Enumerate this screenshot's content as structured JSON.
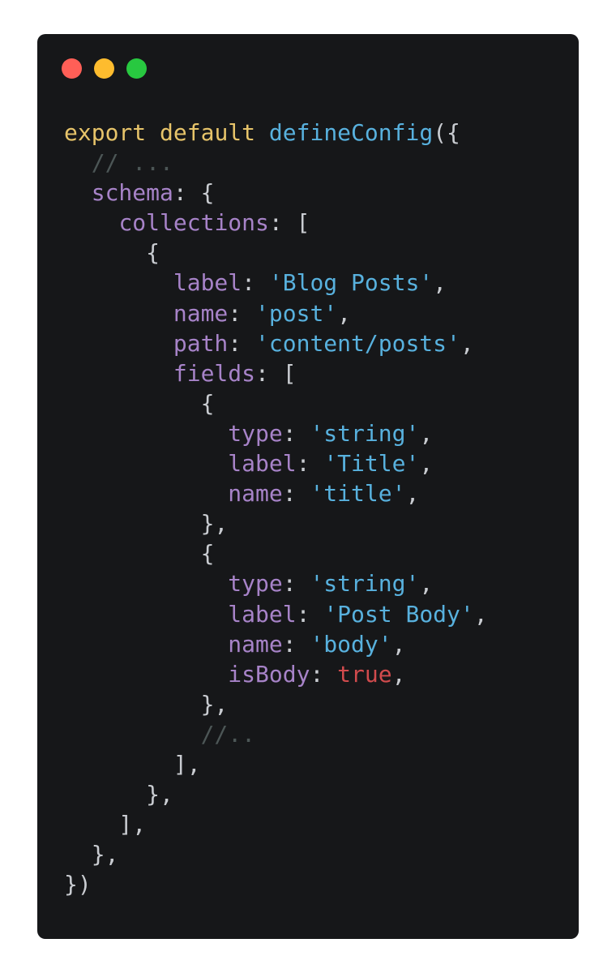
{
  "colors": {
    "background": "#161719",
    "plain": "#c9ccd1",
    "keyword": "#e7c46a",
    "function": "#58b1de",
    "property": "#a783c8",
    "string": "#58b1de",
    "comment": "#4c5656",
    "boolean": "#d14b4d",
    "close_dot": "#ff5f57",
    "minimize_dot": "#febc2e",
    "zoom_dot": "#28c840"
  },
  "code_lines": [
    [
      {
        "t": "keyword",
        "v": "export"
      },
      {
        "t": "plain",
        "v": " "
      },
      {
        "t": "keyword",
        "v": "default"
      },
      {
        "t": "plain",
        "v": " "
      },
      {
        "t": "function",
        "v": "defineConfig"
      },
      {
        "t": "plain",
        "v": "({"
      }
    ],
    [
      {
        "t": "plain",
        "v": "  "
      },
      {
        "t": "comment",
        "v": "// ..."
      }
    ],
    [
      {
        "t": "plain",
        "v": "  "
      },
      {
        "t": "property",
        "v": "schema"
      },
      {
        "t": "plain",
        "v": ": {"
      }
    ],
    [
      {
        "t": "plain",
        "v": "    "
      },
      {
        "t": "property",
        "v": "collections"
      },
      {
        "t": "plain",
        "v": ": ["
      }
    ],
    [
      {
        "t": "plain",
        "v": "      {"
      }
    ],
    [
      {
        "t": "plain",
        "v": "        "
      },
      {
        "t": "property",
        "v": "label"
      },
      {
        "t": "plain",
        "v": ": "
      },
      {
        "t": "string",
        "v": "'Blog Posts'"
      },
      {
        "t": "plain",
        "v": ","
      }
    ],
    [
      {
        "t": "plain",
        "v": "        "
      },
      {
        "t": "property",
        "v": "name"
      },
      {
        "t": "plain",
        "v": ": "
      },
      {
        "t": "string",
        "v": "'post'"
      },
      {
        "t": "plain",
        "v": ","
      }
    ],
    [
      {
        "t": "plain",
        "v": "        "
      },
      {
        "t": "property",
        "v": "path"
      },
      {
        "t": "plain",
        "v": ": "
      },
      {
        "t": "string",
        "v": "'content/posts'"
      },
      {
        "t": "plain",
        "v": ","
      }
    ],
    [
      {
        "t": "plain",
        "v": "        "
      },
      {
        "t": "property",
        "v": "fields"
      },
      {
        "t": "plain",
        "v": ": ["
      }
    ],
    [
      {
        "t": "plain",
        "v": "          {"
      }
    ],
    [
      {
        "t": "plain",
        "v": "            "
      },
      {
        "t": "property",
        "v": "type"
      },
      {
        "t": "plain",
        "v": ": "
      },
      {
        "t": "string",
        "v": "'string'"
      },
      {
        "t": "plain",
        "v": ","
      }
    ],
    [
      {
        "t": "plain",
        "v": "            "
      },
      {
        "t": "property",
        "v": "label"
      },
      {
        "t": "plain",
        "v": ": "
      },
      {
        "t": "string",
        "v": "'Title'"
      },
      {
        "t": "plain",
        "v": ","
      }
    ],
    [
      {
        "t": "plain",
        "v": "            "
      },
      {
        "t": "property",
        "v": "name"
      },
      {
        "t": "plain",
        "v": ": "
      },
      {
        "t": "string",
        "v": "'title'"
      },
      {
        "t": "plain",
        "v": ","
      }
    ],
    [
      {
        "t": "plain",
        "v": "          },"
      }
    ],
    [
      {
        "t": "plain",
        "v": "          {"
      }
    ],
    [
      {
        "t": "plain",
        "v": "            "
      },
      {
        "t": "property",
        "v": "type"
      },
      {
        "t": "plain",
        "v": ": "
      },
      {
        "t": "string",
        "v": "'string'"
      },
      {
        "t": "plain",
        "v": ","
      }
    ],
    [
      {
        "t": "plain",
        "v": "            "
      },
      {
        "t": "property",
        "v": "label"
      },
      {
        "t": "plain",
        "v": ": "
      },
      {
        "t": "string",
        "v": "'Post Body'"
      },
      {
        "t": "plain",
        "v": ","
      }
    ],
    [
      {
        "t": "plain",
        "v": "            "
      },
      {
        "t": "property",
        "v": "name"
      },
      {
        "t": "plain",
        "v": ": "
      },
      {
        "t": "string",
        "v": "'body'"
      },
      {
        "t": "plain",
        "v": ","
      }
    ],
    [
      {
        "t": "plain",
        "v": "            "
      },
      {
        "t": "property",
        "v": "isBody"
      },
      {
        "t": "plain",
        "v": ": "
      },
      {
        "t": "boolean",
        "v": "true"
      },
      {
        "t": "plain",
        "v": ","
      }
    ],
    [
      {
        "t": "plain",
        "v": "          },"
      }
    ],
    [
      {
        "t": "plain",
        "v": "          "
      },
      {
        "t": "comment",
        "v": "//.."
      }
    ],
    [
      {
        "t": "plain",
        "v": "        ],"
      }
    ],
    [
      {
        "t": "plain",
        "v": "      },"
      }
    ],
    [
      {
        "t": "plain",
        "v": "    ],"
      }
    ],
    [
      {
        "t": "plain",
        "v": "  },"
      }
    ],
    [
      {
        "t": "plain",
        "v": "})"
      }
    ]
  ]
}
